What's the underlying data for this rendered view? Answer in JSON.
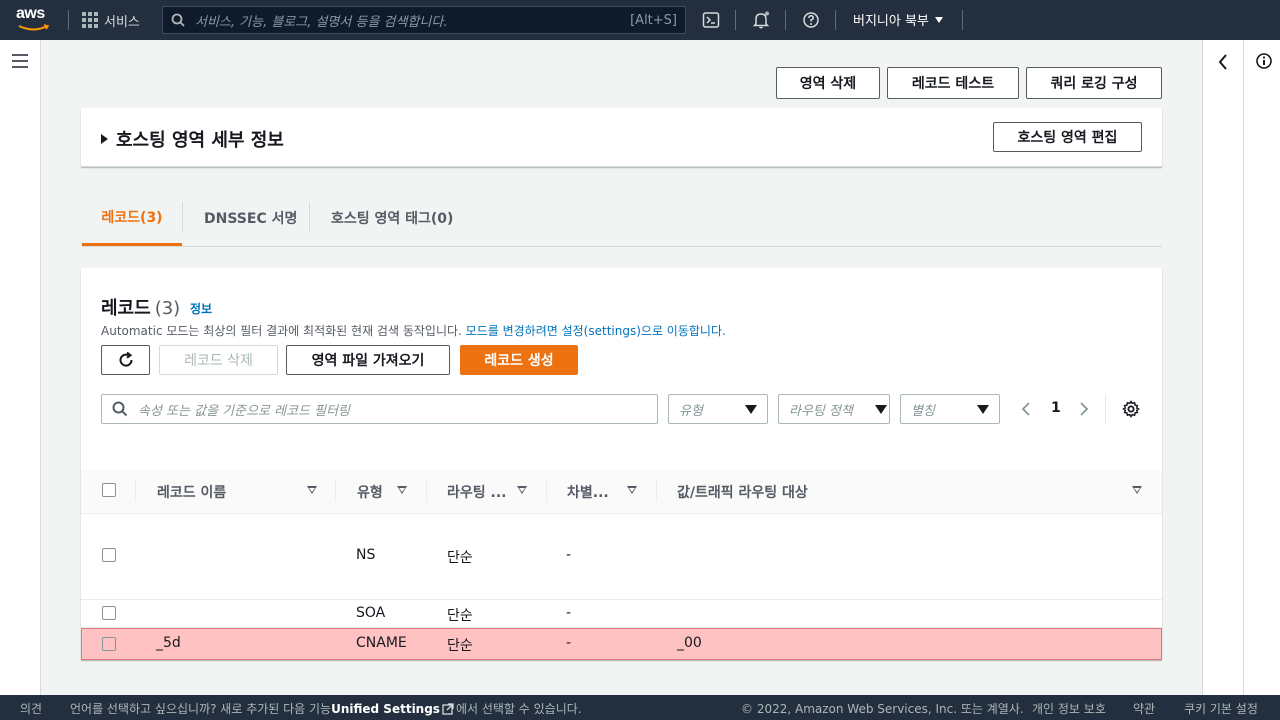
{
  "nav": {
    "logo": "aws",
    "services": "서비스",
    "search_placeholder": "서비스, 기능, 블로그, 설명서 등을 검색합니다.",
    "search_shortcut": "[Alt+S]",
    "region": "버지니아 북부"
  },
  "header_buttons": {
    "delete_zone": "영역 삭제",
    "test_record": "레코드 테스트",
    "query_logging": "쿼리 로깅 구성"
  },
  "details": {
    "title": "호스팅 영역 세부 정보",
    "edit_button": "호스팅 영역 편집"
  },
  "tabs": [
    {
      "label": "레코드(3)",
      "active": true
    },
    {
      "label": "DNSSEC 서명",
      "active": false
    },
    {
      "label": "호스팅 영역 태그(0)",
      "active": false
    }
  ],
  "records": {
    "title": "레코드",
    "count": "(3)",
    "info": "정보",
    "desc_prefix": "Automatic 모드는 최상의 필터 결과에 최적화된 현재 검색 동작입니다. ",
    "desc_link": "모드를 변경하려면 설정(settings)으로 이동합니다.",
    "delete_button": "레코드 삭제",
    "import_button": "영역 파일 가져오기",
    "create_button": "레코드 생성",
    "filter_placeholder": "속성 또는 값을 기준으로 레코드 필터링",
    "type_filter": "유형",
    "routing_filter": "라우팅 정책",
    "alias_filter": "별칭",
    "page": "1",
    "columns": [
      "레코드 이름",
      "유형",
      "라우팅 ...",
      "차별...",
      "값/트래픽 라우팅 대상"
    ],
    "rows": [
      {
        "name": "",
        "type": "NS",
        "routing": "단순",
        "diff": "-",
        "value": ""
      },
      {
        "name": "",
        "type": "SOA",
        "routing": "단순",
        "diff": "-",
        "value": ""
      },
      {
        "name": "_5d",
        "type": "CNAME",
        "routing": "단순",
        "diff": "-",
        "value": "_00"
      }
    ]
  },
  "footer": {
    "feedback": "의견",
    "lang_prefix": "언어를 선택하고 싶으십니까? 새로 추가된 다음 기능",
    "lang_bold": "Unified Settings",
    "lang_suffix": "에서 선택할 수 있습니다.",
    "copyright": "© 2022, Amazon Web Services, Inc. 또는 계열사.",
    "privacy": "개인 정보 보호",
    "terms": "약관",
    "cookies": "쿠키 기본 설정"
  },
  "colors": {
    "nav_bg": "#232f3e",
    "accent": "#ec7211",
    "link": "#0073bb",
    "highlight_row": "#ffc2c2"
  }
}
